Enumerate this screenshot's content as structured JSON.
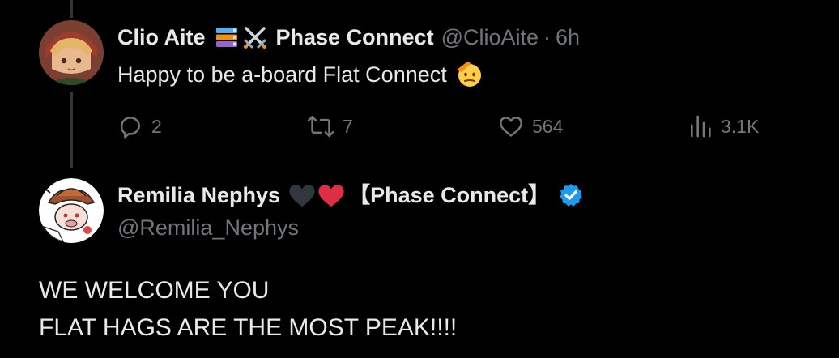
{
  "tweet1": {
    "display_name": "Clio Aite",
    "affiliation": "Phase Connect",
    "handle": "@ClioAite",
    "separator": "·",
    "time": "6h",
    "text": "Happy to be a-board Flat Connect",
    "stats": {
      "replies": "2",
      "retweets": "7",
      "likes": "564",
      "views": "3.1K"
    },
    "icons": [
      "books-emoji",
      "crossed-swords-emoji",
      "saluting-face-emoji",
      "reply-icon",
      "retweet-icon",
      "like-icon",
      "views-icon"
    ]
  },
  "tweet2": {
    "display_name": "Remilia Nephys",
    "affiliation": "【Phase Connect】",
    "handle": "@Remilia_Nephys",
    "verified": true,
    "lines": [
      "WE WELCOME YOU",
      "FLAT HAGS ARE THE MOST PEAK!!!!"
    ],
    "icons": [
      "black-heart-emoji",
      "red-heart-emoji",
      "verified-badge-icon"
    ]
  },
  "colors": {
    "background": "#000000",
    "text": "#e7e9ea",
    "muted": "#71767b",
    "thread_line": "#333639",
    "verified": "#1d9bf0",
    "heart_red": "#dd2e44"
  }
}
